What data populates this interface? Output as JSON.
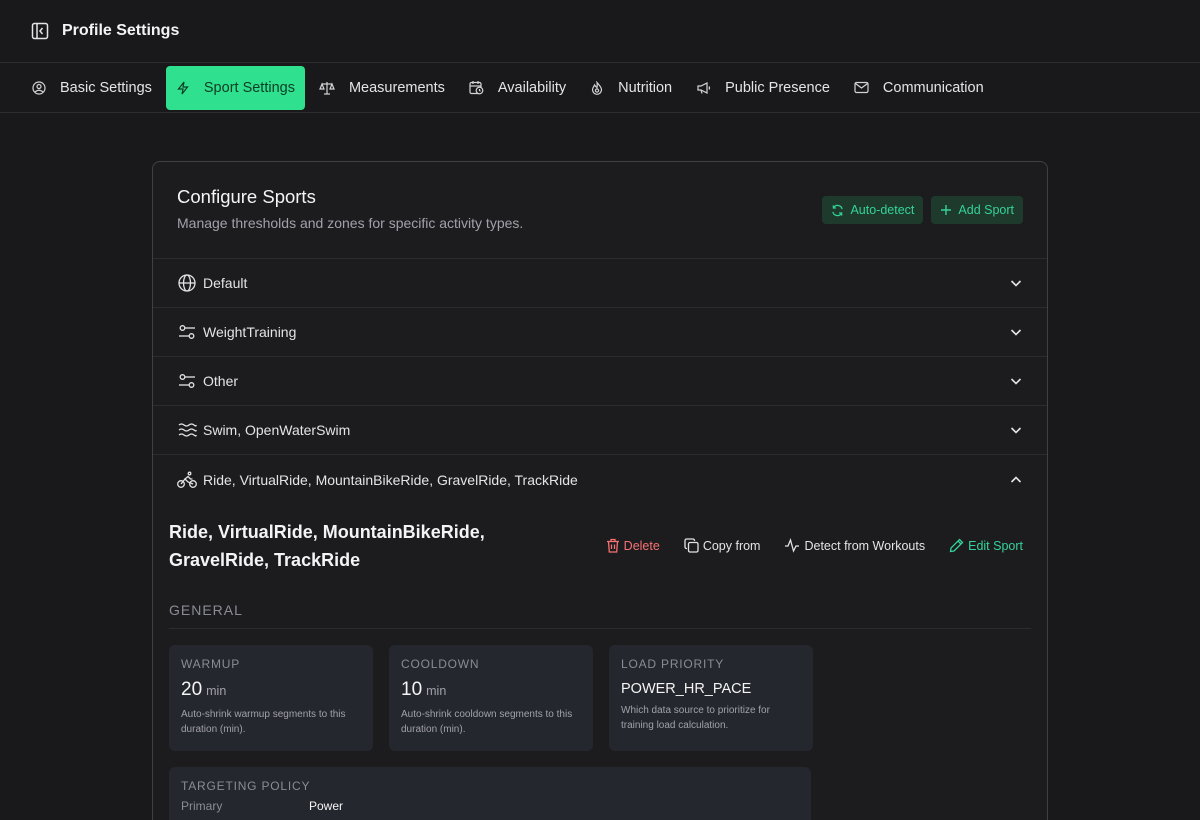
{
  "header": {
    "title": "Profile Settings",
    "sidebar_toggle_icon": "sidebar-collapse-icon"
  },
  "tabs": [
    {
      "label": "Basic Settings",
      "icon": "user-circle-icon",
      "active": false
    },
    {
      "label": "Sport Settings",
      "icon": "lightning-icon",
      "active": true
    },
    {
      "label": "Measurements",
      "icon": "scale-icon",
      "active": false
    },
    {
      "label": "Availability",
      "icon": "calendar-clock-icon",
      "active": false
    },
    {
      "label": "Nutrition",
      "icon": "flame-icon",
      "active": false
    },
    {
      "label": "Public Presence",
      "icon": "megaphone-icon",
      "active": false
    },
    {
      "label": "Communication",
      "icon": "mail-icon",
      "active": false
    }
  ],
  "card": {
    "title": "Configure Sports",
    "subtitle": "Manage thresholds and zones for specific activity types.",
    "auto_detect_label": "Auto-detect",
    "add_sport_label": "Add Sport"
  },
  "sports": [
    {
      "label": "Default",
      "icon": "globe-icon",
      "expanded": false
    },
    {
      "label": "WeightTraining",
      "icon": "sliders-icon",
      "expanded": false
    },
    {
      "label": "Other",
      "icon": "sliders-icon",
      "expanded": false
    },
    {
      "label": "Swim, OpenWaterSwim",
      "icon": "waves-icon",
      "expanded": false
    },
    {
      "label": "Ride, VirtualRide, MountainBikeRide, GravelRide, TrackRide",
      "icon": "bike-icon",
      "expanded": true
    }
  ],
  "detail": {
    "title": "Ride, VirtualRide, MountainBikeRide, GravelRide, TrackRide",
    "delete_label": "Delete",
    "copy_label": "Copy from",
    "detect_label": "Detect from Workouts",
    "edit_label": "Edit Sport",
    "section_general": "GENERAL",
    "warmup": {
      "label": "WARMUP",
      "value": "20",
      "unit": "min",
      "desc": "Auto-shrink warmup segments to this duration (min)."
    },
    "cooldown": {
      "label": "COOLDOWN",
      "value": "10",
      "unit": "min",
      "desc": "Auto-shrink cooldown segments to this duration (min)."
    },
    "load_priority": {
      "label": "LOAD PRIORITY",
      "value": "POWER_HR_PACE",
      "desc": "Which data source to prioritize for training load calculation."
    },
    "targeting": {
      "label": "TARGETING POLICY",
      "primary_key": "Primary",
      "primary_value": "Power"
    }
  },
  "colors": {
    "accent": "#2fe08e",
    "danger": "#f87171",
    "background": "#19191b"
  }
}
